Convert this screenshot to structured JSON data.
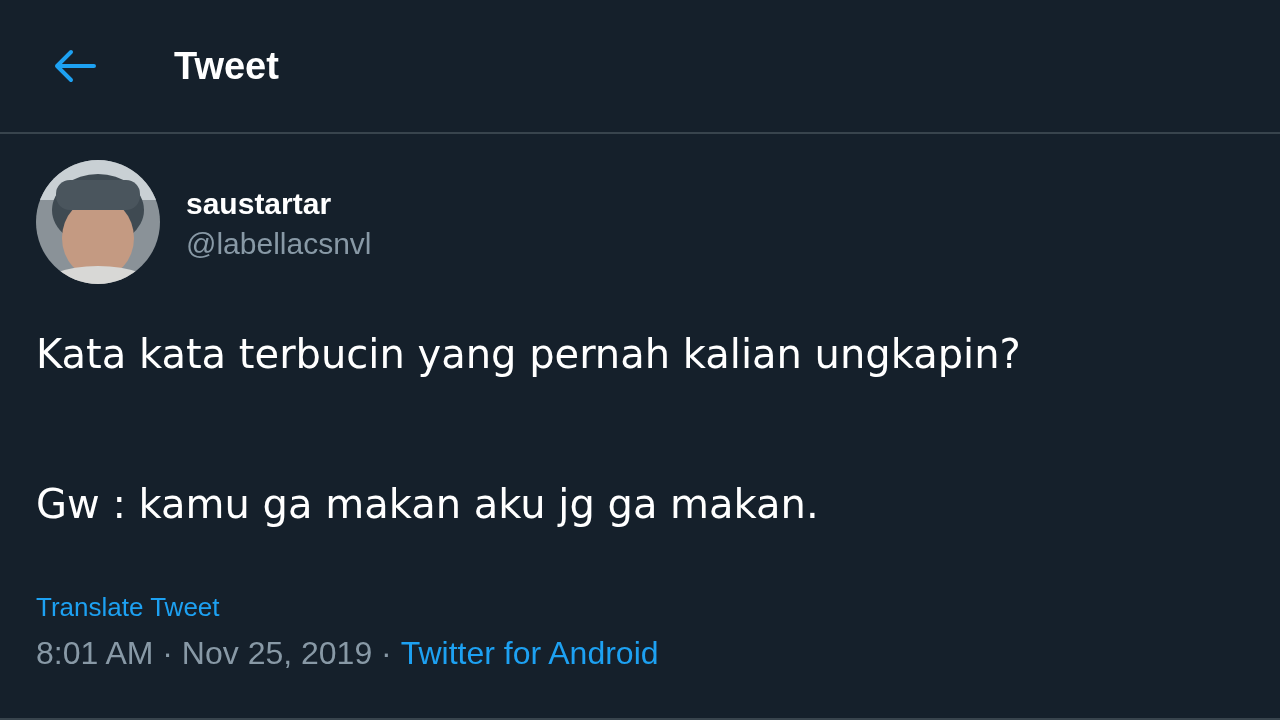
{
  "header": {
    "title": "Tweet"
  },
  "tweet": {
    "name": "saustartar",
    "handle": "@labellacsnvl",
    "text_lines": [
      "Kata kata terbucin yang pernah kalian ungkapin?",
      "Gw : kamu ga makan aku jg ga makan."
    ],
    "translate_link": "Translate Tweet",
    "timestamp": "8:01 AM · Nov 25, 2019 · ",
    "source_link": "Twitter for Android"
  }
}
